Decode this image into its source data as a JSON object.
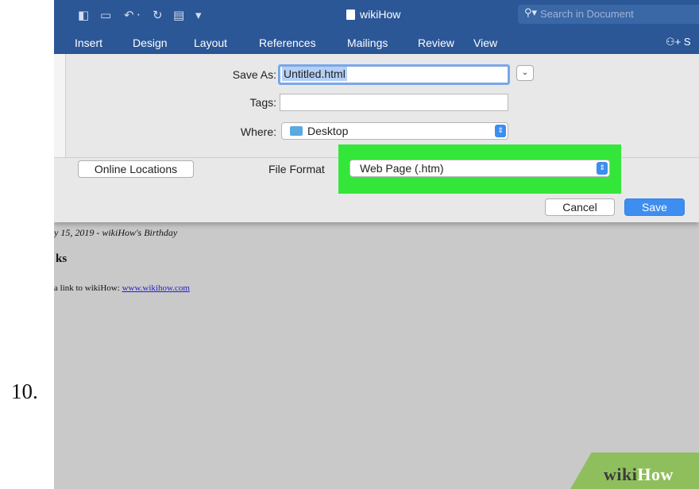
{
  "step_number": "10.",
  "window": {
    "title": "wikiHow",
    "search_placeholder": "Search in Document",
    "share_label": "S"
  },
  "ribbon_tabs": [
    "Insert",
    "Design",
    "Layout",
    "References",
    "Mailings",
    "Review",
    "View"
  ],
  "dialog": {
    "save_as_label": "Save As:",
    "save_as_value": "Untitled.html",
    "tags_label": "Tags:",
    "tags_value": "",
    "where_label": "Where:",
    "where_value": "Desktop",
    "online_locations_label": "Online Locations",
    "file_format_label": "File Format",
    "file_format_value": "Web Page (.htm)",
    "cancel_label": "Cancel",
    "save_label": "Save"
  },
  "document": {
    "date_line": "y 15, 2019 - wikiHow's Birthday",
    "heading_fragment": "ks",
    "link_prefix": "a link to wikiHow: ",
    "link_text": "www.wikihow.com"
  },
  "watermark": {
    "part1": "wiki",
    "part2": "How"
  },
  "colors": {
    "title_bar": "#2b5797",
    "highlight": "#34e63a",
    "accent_button": "#3d8ef0"
  }
}
